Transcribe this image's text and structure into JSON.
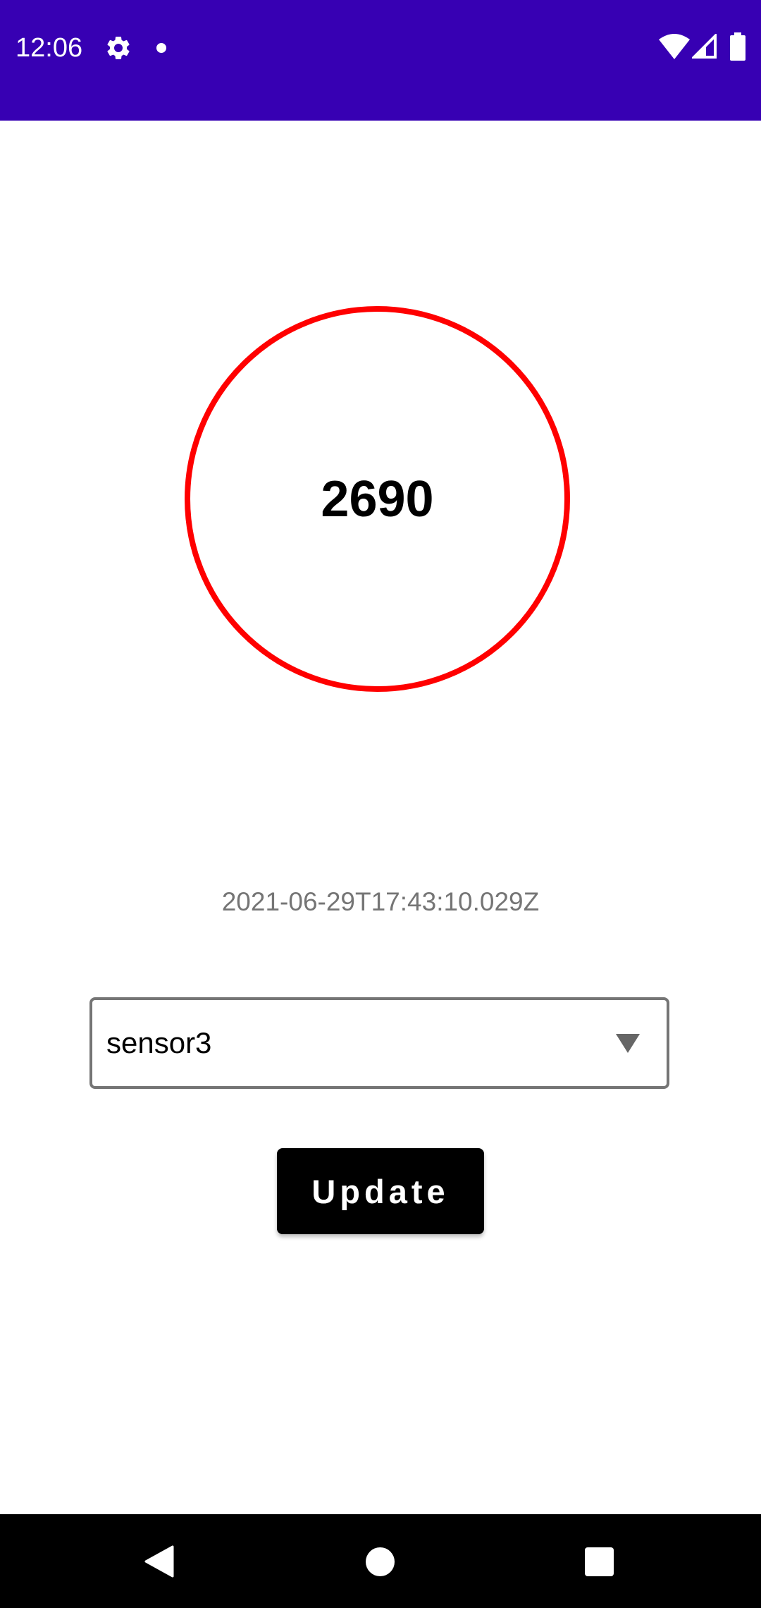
{
  "status_bar": {
    "time": "12:06",
    "icons": [
      "gear-icon",
      "notification-dot-icon",
      "wifi-icon",
      "signal-icon",
      "battery-icon"
    ],
    "background": "#3700b3"
  },
  "gauge": {
    "value": "2690",
    "ring_color": "#ff0000"
  },
  "timestamp": "2021-06-29T17:43:10.029Z",
  "sensor_select": {
    "selected": "sensor3"
  },
  "update_button": {
    "label": "Update"
  },
  "nav_bar": {
    "icons": [
      "back-icon",
      "home-icon",
      "recents-icon"
    ]
  }
}
